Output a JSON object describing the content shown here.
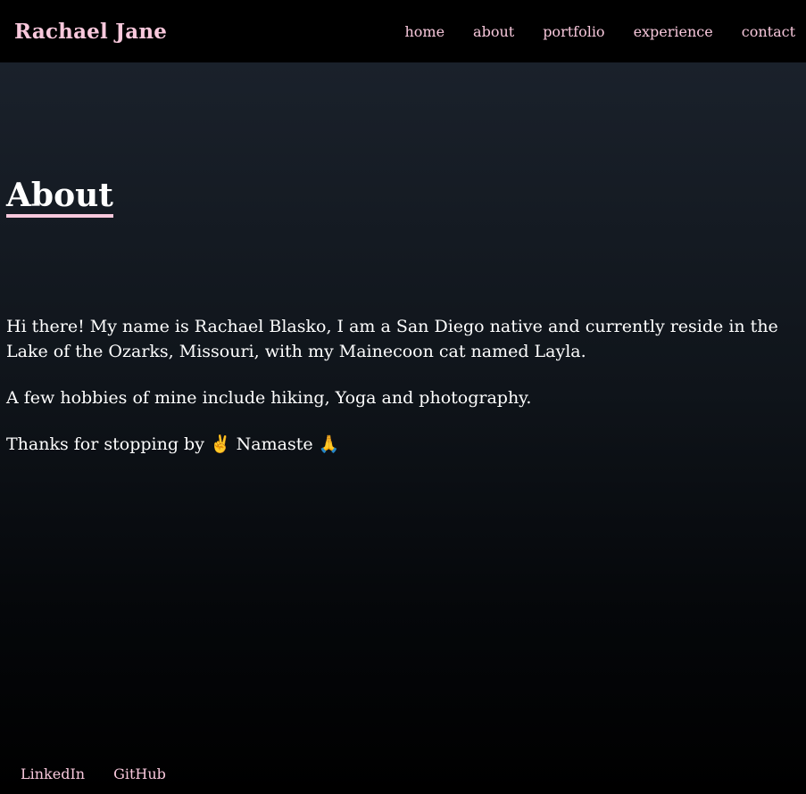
{
  "navbar": {
    "brand": "Rachael Jane",
    "links": [
      "home",
      "about",
      "portfolio",
      "experience",
      "contact"
    ]
  },
  "about": {
    "heading": "About",
    "paragraphs": [
      "Hi there! My name is Rachael Blasko, I am a San Diego native and currently reside in the Lake of the Ozarks, Missouri, with my Mainecoon cat named Layla.",
      "A few hobbies of mine include hiking, Yoga and photography.",
      "Thanks for stopping by ✌️ Namaste 🙏"
    ]
  },
  "footer": {
    "links": [
      "LinkedIn",
      "GitHub"
    ]
  },
  "colors": {
    "accent": "#f8c8dc",
    "nav_background": "#000000",
    "text": "#ffffff"
  }
}
